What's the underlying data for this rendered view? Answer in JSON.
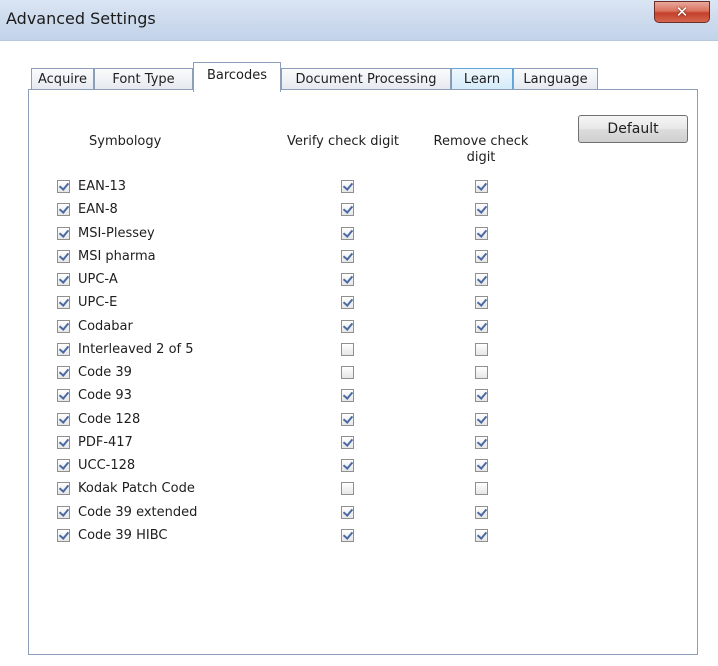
{
  "window": {
    "title": "Advanced Settings",
    "close_glyph": "✕"
  },
  "tabs": [
    {
      "label": "Acquire",
      "state": "normal"
    },
    {
      "label": "Font Type",
      "state": "normal"
    },
    {
      "label": "Barcodes",
      "state": "selected"
    },
    {
      "label": "Document Processing",
      "state": "normal"
    },
    {
      "label": "Learn",
      "state": "hover"
    },
    {
      "label": "Language",
      "state": "normal"
    }
  ],
  "barcodes": {
    "headers": {
      "symbology": "Symbology",
      "verify_line": "Verify check digit",
      "remove_line1": "Remove check",
      "remove_line2": "digit"
    },
    "default_label": "Default",
    "rows": [
      {
        "name": "EAN-13",
        "enabled": true,
        "verify": true,
        "remove": true
      },
      {
        "name": "EAN-8",
        "enabled": true,
        "verify": true,
        "remove": true
      },
      {
        "name": "MSI-Plessey",
        "enabled": true,
        "verify": true,
        "remove": true
      },
      {
        "name": "MSI pharma",
        "enabled": true,
        "verify": true,
        "remove": true
      },
      {
        "name": "UPC-A",
        "enabled": true,
        "verify": true,
        "remove": true
      },
      {
        "name": "UPC-E",
        "enabled": true,
        "verify": true,
        "remove": true
      },
      {
        "name": "Codabar",
        "enabled": true,
        "verify": true,
        "remove": true
      },
      {
        "name": "Interleaved 2 of 5",
        "enabled": true,
        "verify": false,
        "remove": false
      },
      {
        "name": "Code 39",
        "enabled": true,
        "verify": false,
        "remove": false
      },
      {
        "name": "Code 93",
        "enabled": true,
        "verify": true,
        "remove": true
      },
      {
        "name": "Code 128",
        "enabled": true,
        "verify": true,
        "remove": true
      },
      {
        "name": "PDF-417",
        "enabled": true,
        "verify": true,
        "remove": true
      },
      {
        "name": "UCC-128",
        "enabled": true,
        "verify": true,
        "remove": true
      },
      {
        "name": "Kodak Patch Code",
        "enabled": true,
        "verify": false,
        "remove": false
      },
      {
        "name": "Code 39 extended",
        "enabled": true,
        "verify": true,
        "remove": true
      },
      {
        "name": "Code 39 HIBC",
        "enabled": true,
        "verify": true,
        "remove": true
      }
    ]
  },
  "colors": {
    "titlebar": "#cfdcee",
    "close_button": "#c4402a",
    "tab_border": "#8d9fb8",
    "hover_tab": "#d3ebfa",
    "check_mark": "#4a6aa4"
  }
}
